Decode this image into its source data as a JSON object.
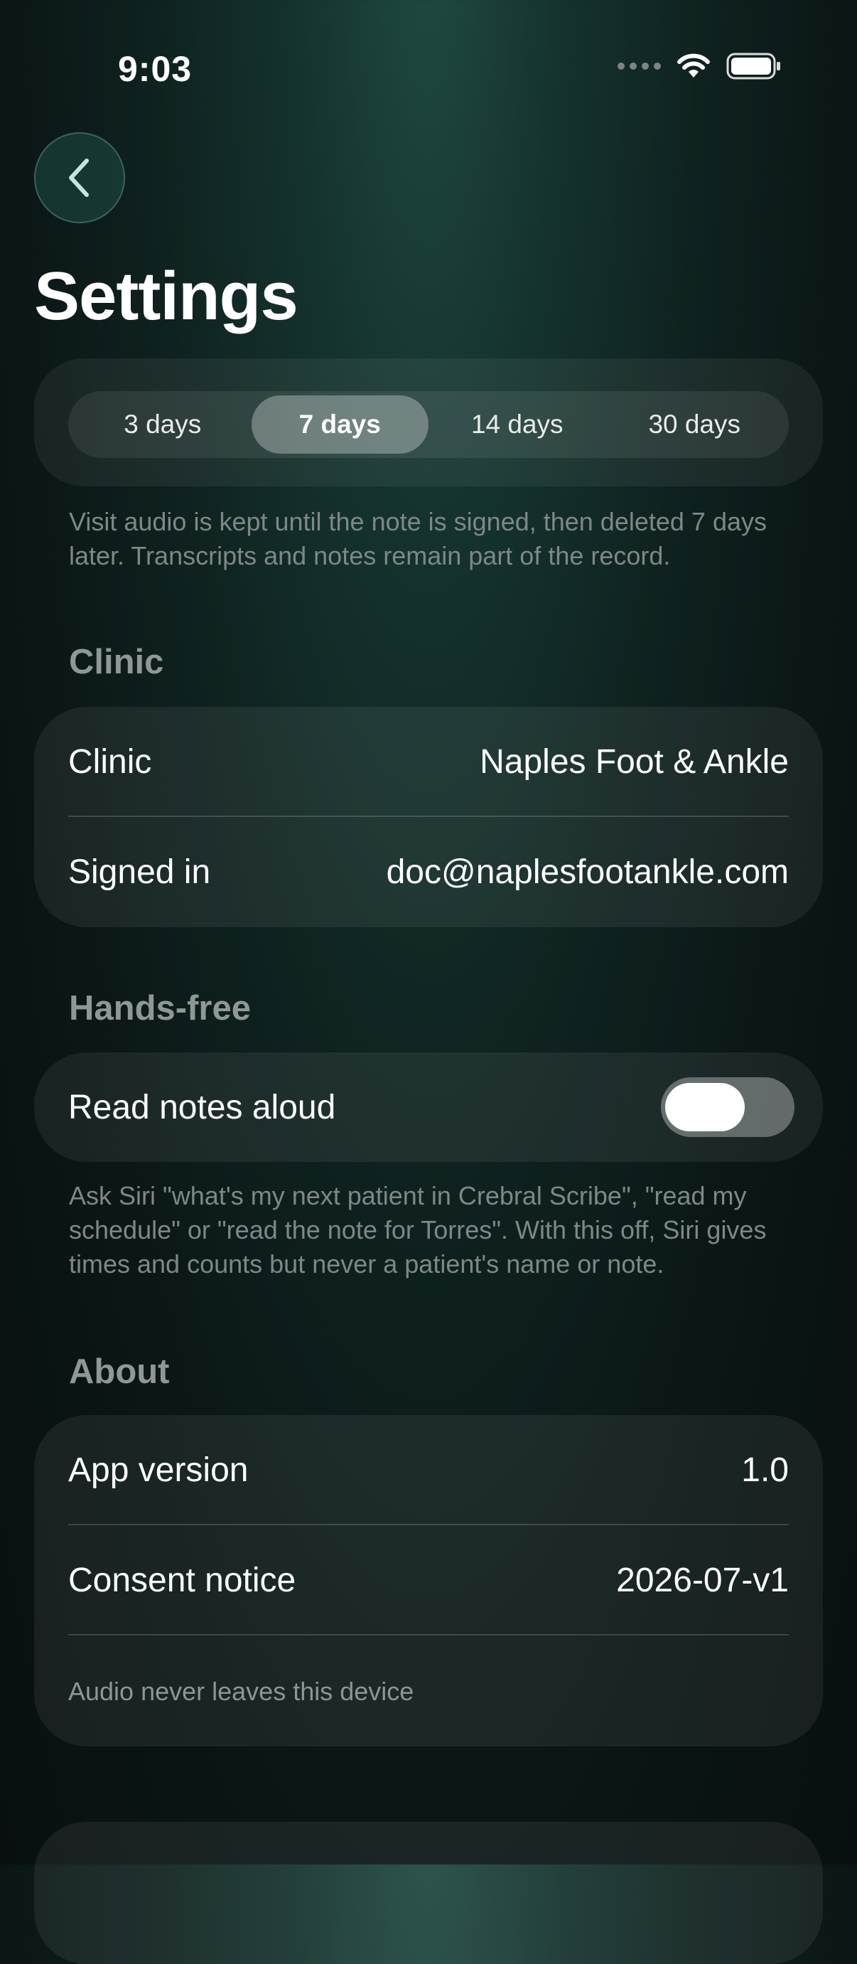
{
  "status_bar": {
    "time": "9:03",
    "icons": [
      "cellular-dots-icon",
      "wifi-icon",
      "battery-icon"
    ]
  },
  "navigation": {
    "back_icon": "chevron-left-icon"
  },
  "page_title": "Settings",
  "audio_retention": {
    "options": [
      "3 days",
      "7 days",
      "14 days",
      "30 days"
    ],
    "selected": "7 days",
    "footnote": "Visit audio is kept until the note is signed, then deleted 7 days later. Transcripts and notes remain part of the record."
  },
  "clinic": {
    "header": "Clinic",
    "rows": [
      {
        "label": "Clinic",
        "value": "Naples Foot & Ankle"
      },
      {
        "label": "Signed in",
        "value": "doc@naplesfootankle.com"
      }
    ]
  },
  "hands_free": {
    "header": "Hands-free",
    "toggle_label": "Read notes aloud",
    "toggle_on": false,
    "footnote": "Ask Siri \"what's my next patient in Crebral Scribe\", \"read my schedule\" or \"read the note for Torres\". With this off, Siri gives times and counts but never a patient's name or note."
  },
  "about": {
    "header": "About",
    "rows": [
      {
        "label": "App version",
        "value": "1.0"
      },
      {
        "label": "Consent notice",
        "value": "2026-07-v1"
      }
    ],
    "note": "Audio never leaves this device"
  },
  "colors": {
    "background_top": "#1f4a42",
    "background_bottom": "#090f10",
    "secondary_text": "#7e8886"
  }
}
